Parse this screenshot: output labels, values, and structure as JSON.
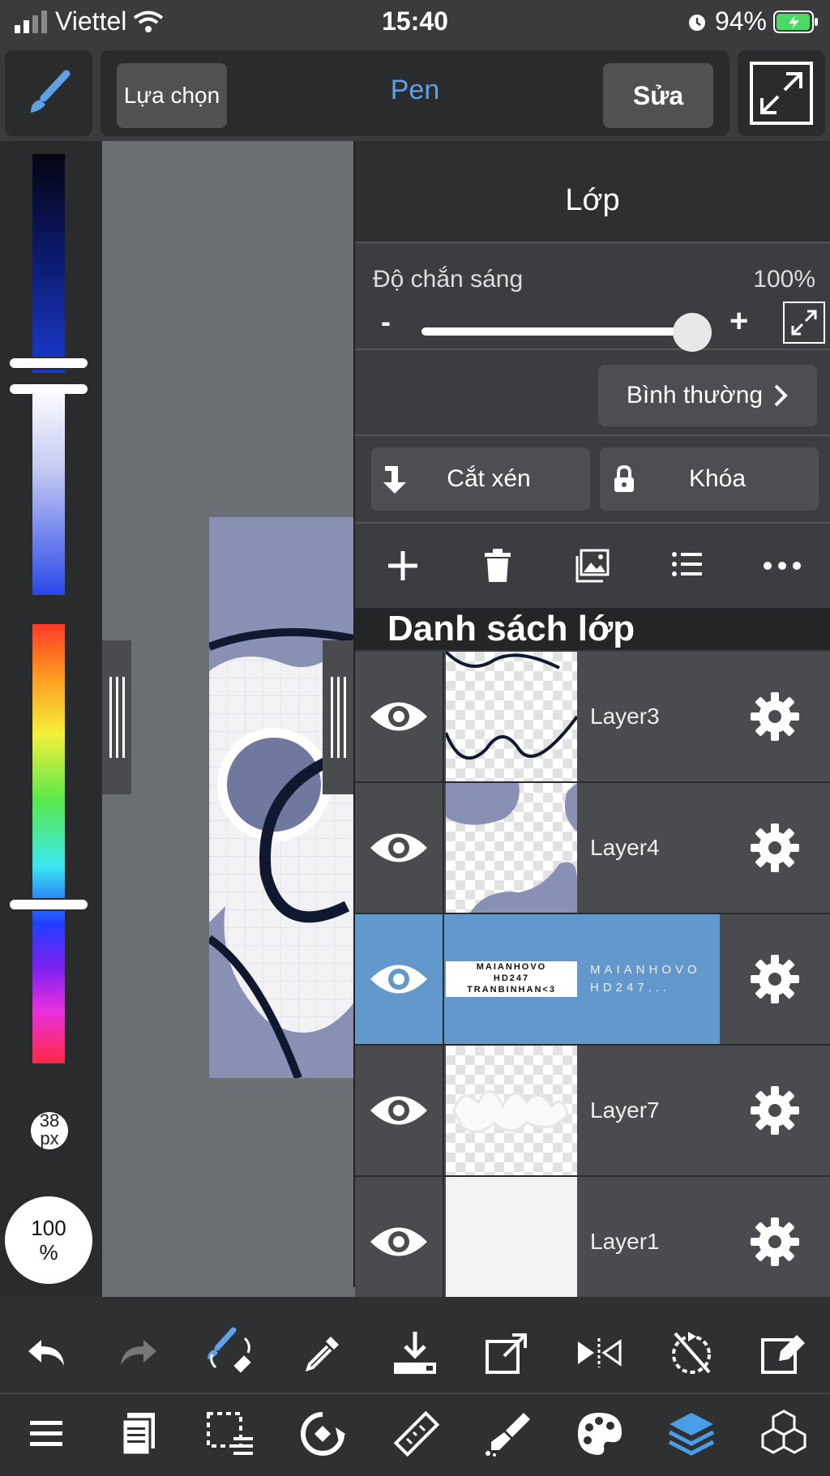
{
  "status_bar": {
    "carrier": "Viettel",
    "time": "15:40",
    "battery": "94%"
  },
  "top_toolbar": {
    "select_label": "Lựa chọn",
    "tool_name": "Pen",
    "edit_label": "Sửa"
  },
  "color_bar": {
    "brush_size": "38",
    "brush_size_unit": "px",
    "opacity_value": "100",
    "opacity_unit": "%"
  },
  "layer_panel": {
    "title": "Lớp",
    "opacity_label": "Độ chắn sáng",
    "opacity_value": "100%",
    "opacity_level": 1.0,
    "minus_label": "-",
    "plus_label": "+",
    "blend_mode": "Bình thường",
    "clipping_label": "Cắt xén",
    "lock_label": "Khóa",
    "list_header": "Danh sách lớp",
    "layers": [
      {
        "name": "Layer3",
        "visible": true,
        "active": false
      },
      {
        "name": "Layer4",
        "visible": true,
        "active": false
      },
      {
        "name_line1": "MAIANHOVO",
        "name_line2": "HD247...",
        "thumb_line1": "MAIANHOVO",
        "thumb_line2": "HD247",
        "thumb_line3": "TRANBINHAN<3",
        "visible": true,
        "active": true
      },
      {
        "name": "Layer7",
        "visible": true,
        "active": false
      },
      {
        "name": "Layer1",
        "visible": true,
        "active": false
      }
    ]
  },
  "colors": {
    "accent": "#6398cc",
    "panel_bg": "#3c3d40",
    "canvas_art": "#8a90b4"
  }
}
